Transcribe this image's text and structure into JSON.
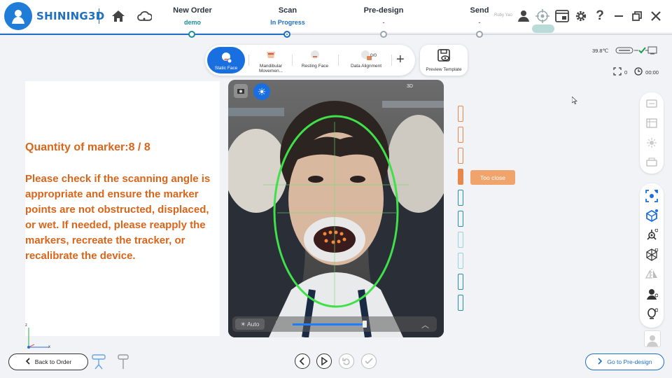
{
  "app": {
    "brand": "SHINING3D",
    "user_name": "Ruby Yao"
  },
  "steps": [
    {
      "title": "New Order",
      "subtitle": "demo",
      "state": "done"
    },
    {
      "title": "Scan",
      "subtitle": "In Progress",
      "state": "active"
    },
    {
      "title": "Pre-design",
      "subtitle": "-",
      "state": "pending"
    },
    {
      "title": "Send",
      "subtitle": "-",
      "state": "pending"
    }
  ],
  "modes": [
    {
      "label": "Static Face",
      "icon": "static-face-icon",
      "active": true
    },
    {
      "label": "Mandibular Movemen...",
      "icon": "mandibular-icon",
      "active": false
    },
    {
      "label": "Resting Face",
      "icon": "resting-face-icon",
      "active": false
    },
    {
      "label": "Data Alignment",
      "icon": "data-alignment-icon",
      "active": false,
      "count": "0/0"
    }
  ],
  "preview_label": "Preview Template",
  "status": {
    "temperature": "39.8℃",
    "point_count": "0",
    "timer": "00:00"
  },
  "info": {
    "marker_quantity": "Quantity of marker:8 / 8",
    "message": "Please check if the scanning angle is appropriate and ensure the marker points are not obstructed, displaced, or wet. If needed, please reapply the markers, recreate the tracker, or recalibrate the device."
  },
  "camera": {
    "auto_label": "☀ Auto",
    "badge": "3D",
    "brightness": 0.85
  },
  "distance": {
    "tooltip": "Too close",
    "current_index": 3
  },
  "colors": {
    "accent": "#1f6fc4",
    "teal": "#1a8f9a",
    "warning": "#d9651a",
    "tooltip": "#f0a36b"
  },
  "bottom": {
    "back_label": "Back to Order",
    "next_label": "Go to Pre-design"
  },
  "axes": {
    "x": "x",
    "y": "z"
  }
}
